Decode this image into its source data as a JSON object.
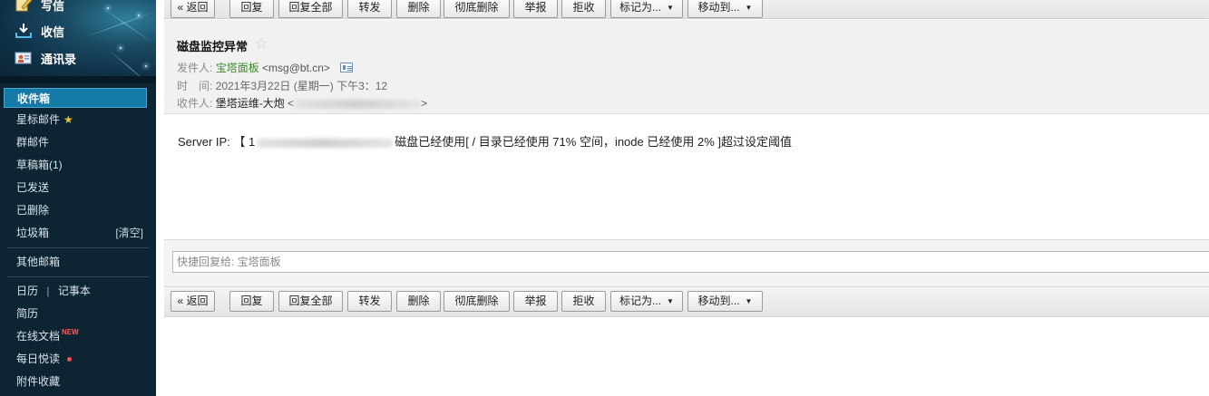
{
  "sidebar": {
    "actions": [
      {
        "label": "写信",
        "icon": "compose-icon"
      },
      {
        "label": "收信",
        "icon": "inbox-download-icon"
      },
      {
        "label": "通讯录",
        "icon": "contacts-icon"
      }
    ],
    "folders": [
      {
        "label": "收件箱",
        "name": "inbox",
        "active": true
      },
      {
        "label": "星标邮件",
        "name": "starred"
      },
      {
        "label": "群邮件",
        "name": "group-mail"
      },
      {
        "label": "草稿箱(1)",
        "name": "drafts"
      },
      {
        "label": "已发送",
        "name": "sent"
      },
      {
        "label": "已删除",
        "name": "deleted"
      },
      {
        "label": "垃圾箱",
        "name": "spam",
        "right": "[清空]"
      }
    ],
    "other_mailboxes": "其他邮箱",
    "calendar": "日历",
    "calendar_sep": "|",
    "notes": "记事本",
    "resume": "简历",
    "online_docs": "在线文档",
    "online_docs_badge": "NEW",
    "daily_read": "每日悦读",
    "attachments": "附件收藏"
  },
  "toolbar": {
    "back": "« 返回",
    "reply": "回复",
    "reply_all": "回复全部",
    "forward": "转发",
    "delete": "删除",
    "delete_permanently": "彻底删除",
    "report": "举报",
    "reject": "拒收",
    "mark_as": "标记为...",
    "move_to": "移动到..."
  },
  "mail": {
    "subject": "磁盘监控异常",
    "star": "☆",
    "from_label": "发件人:",
    "from_name": "宝塔面板",
    "from_addr": "<msg@bt.cn>",
    "time_label": "时　间:",
    "time_value": "2021年3月22日 (星期一) 下午3：12",
    "to_label": "收件人:",
    "to_name": "堡塔运维-大炮",
    "to_addr_open": "<",
    "to_addr_close": ">",
    "body_prefix": "Server IP: 【 1",
    "body_suffix": "磁盘已经使用[ / 目录已经使用 71% 空间，inode 已经使用 2% ]超过设定阈值"
  },
  "quick_reply": {
    "placeholder": "快捷回复给: 宝塔面板"
  },
  "colors": {
    "sidebar_bg": "#0d2533",
    "active_folder": "#1479a6",
    "sender_green": "#3c8b2a"
  }
}
